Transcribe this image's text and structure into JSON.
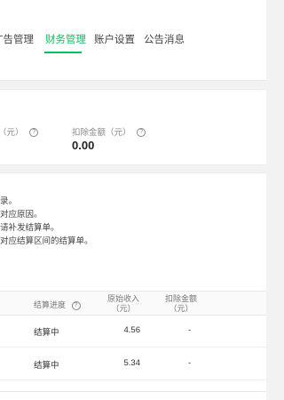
{
  "nav": {
    "tabs": [
      {
        "label": "广告管理"
      },
      {
        "label": "财务管理"
      },
      {
        "label": "账户设置"
      },
      {
        "label": "公告消息"
      }
    ],
    "active_index": 1
  },
  "stats": {
    "left_label": "（元）",
    "deduct_label": "扣除金额（元）",
    "deduct_value": "0.00"
  },
  "notes": [
    "录。",
    "对应原因。",
    "请补发结算单。",
    "对应结算区间的结算单。"
  ],
  "table": {
    "headers": {
      "status": "结算进度",
      "income": "原始收入（元）",
      "deduct": "扣除金额（元）"
    },
    "rows": [
      {
        "status": "结算中",
        "income": "4.56",
        "deduct": "-"
      },
      {
        "status": "结算中",
        "income": "5.34",
        "deduct": "-"
      }
    ]
  },
  "colors": {
    "accent": "#07c160"
  }
}
